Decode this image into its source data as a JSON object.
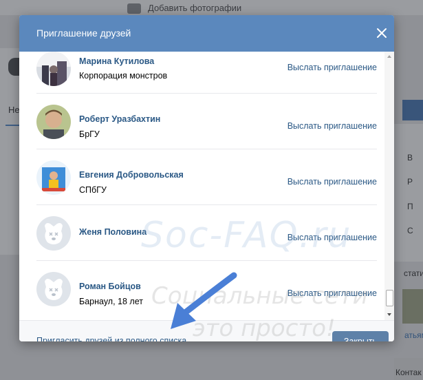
{
  "background": {
    "top_link": "Добавить фотографии",
    "left_tab": "Не",
    "right_labels": [
      "В",
      "Р",
      "П",
      "С"
    ],
    "right_stat": "стати",
    "right_link": "атьям",
    "bottom_right": "Контак"
  },
  "modal": {
    "title": "Приглашение друзей",
    "friends": [
      {
        "name": "Марина Кутилова",
        "subtitle": "Корпорация монстров",
        "action": "Выслать приглашение",
        "avatar": "photo"
      },
      {
        "name": "Роберт Уразбахтин",
        "subtitle": "БрГУ",
        "action": "Выслать приглашение",
        "avatar": "photo"
      },
      {
        "name": "Евгения Добровольская",
        "subtitle": "СПбГУ",
        "action": "Выслать приглашение",
        "avatar": "photo"
      },
      {
        "name": "Женя Половина",
        "subtitle": "",
        "action": "Выслать приглашение",
        "avatar": "default-dog"
      },
      {
        "name": "Роман Бойцов",
        "subtitle": "Барнаул, 18 лет",
        "action": "Выслать приглашение",
        "avatar": "default-dog"
      }
    ],
    "footer_link": "Пригласить друзей из полного списка",
    "close_button": "Закрыть"
  },
  "watermark": {
    "line1": "Soc-FAQ.ru",
    "line2": "Социальные сети",
    "line3": "это просто!"
  },
  "colors": {
    "header": "#5b88bd",
    "link": "#2a5885",
    "button": "#5e81a8",
    "arrow": "#4a7fd6"
  }
}
